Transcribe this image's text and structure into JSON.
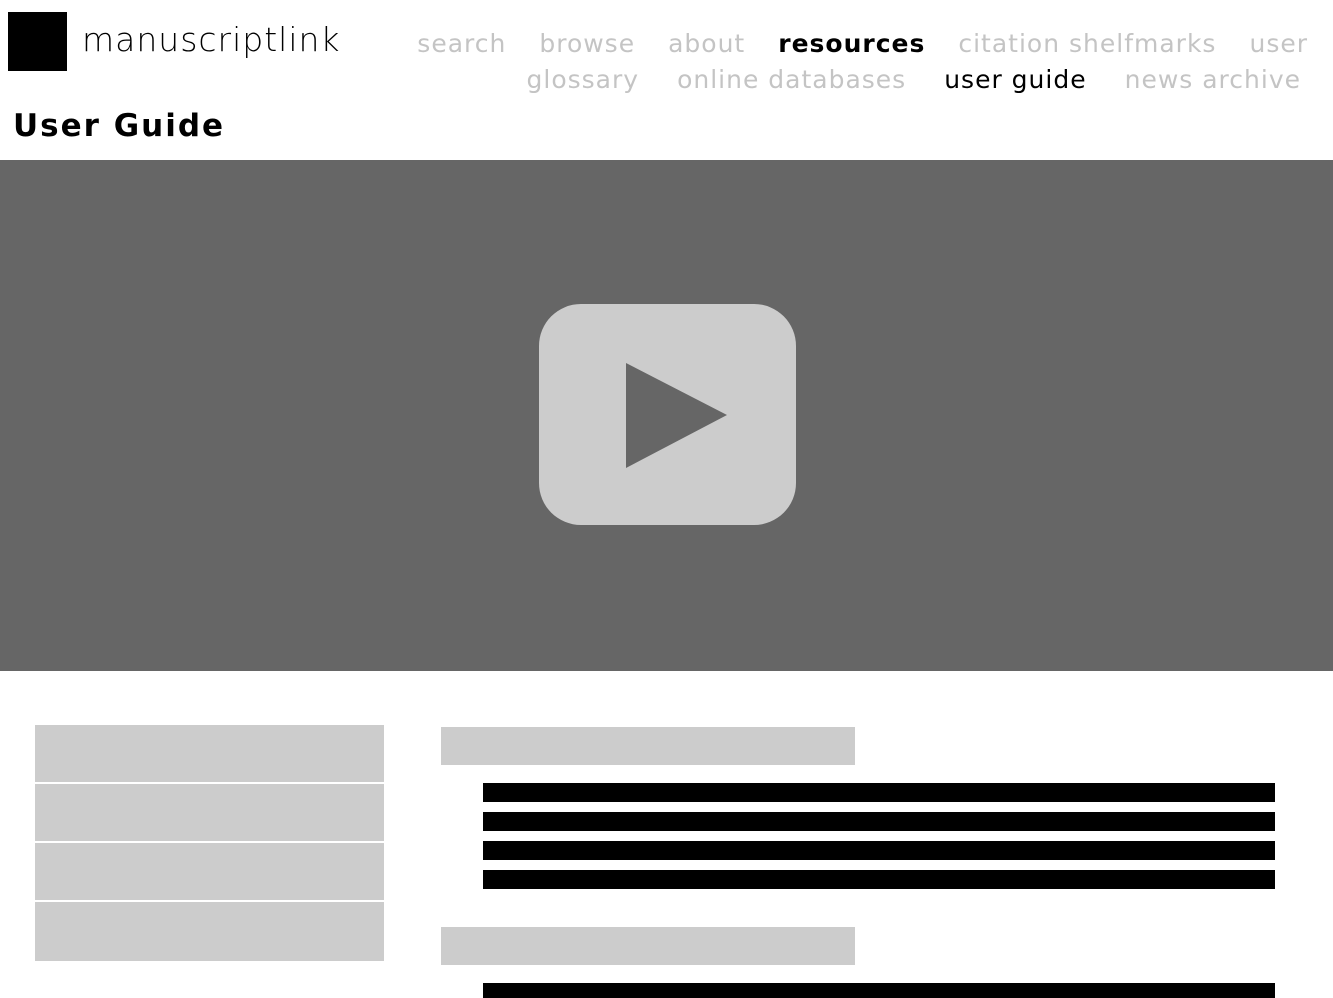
{
  "brand": {
    "name": "manuscriptlink"
  },
  "nav": {
    "primary": [
      {
        "label": "search",
        "state": "inactive"
      },
      {
        "label": "browse",
        "state": "inactive"
      },
      {
        "label": "about",
        "state": "inactive"
      },
      {
        "label": "resources",
        "state": "current"
      },
      {
        "label": "citation shelfmarks",
        "state": "inactive"
      },
      {
        "label": "user",
        "state": "inactive"
      }
    ],
    "secondary": [
      {
        "label": "glossary",
        "state": "inactive"
      },
      {
        "label": "online databases",
        "state": "inactive"
      },
      {
        "label": "user guide",
        "state": "current"
      },
      {
        "label": "news archive",
        "state": "inactive"
      }
    ]
  },
  "page": {
    "title": "User Guide"
  },
  "video": {
    "icon": "play-icon"
  },
  "colors": {
    "nav_inactive": "#c4c4c4",
    "video_bg": "#666666",
    "placeholder": "#cccccc",
    "text_block": "#000000"
  }
}
